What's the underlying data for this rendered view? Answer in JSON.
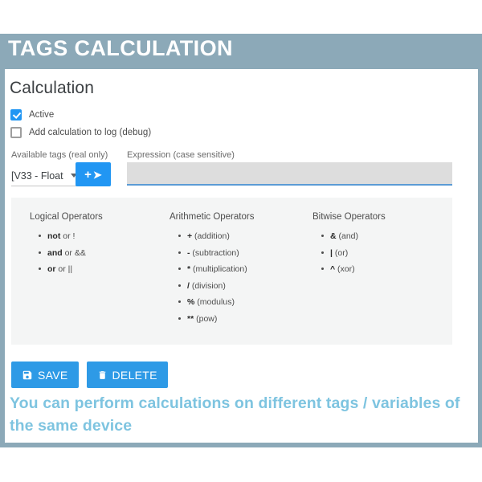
{
  "header": {
    "title": "TAGS CALCULATION",
    "bar_color": "#8ca9b8"
  },
  "card": {
    "title": "Calculation",
    "checkboxes": [
      {
        "label": "Active",
        "checked": true
      },
      {
        "label": "Add calculation to log (debug)",
        "checked": false
      }
    ],
    "tags_field": {
      "label": "Available tags (real only)",
      "selected_option": "[V33 - Float",
      "add_button": {
        "plus_icon": "+",
        "arrow_icon": "➤"
      }
    },
    "expression_field": {
      "label": "Expression (case sensitive)",
      "value": "",
      "placeholder": ""
    }
  },
  "help": {
    "columns": [
      {
        "heading": "Logical Operators",
        "items": [
          {
            "symbol": "not",
            "rest": " or !"
          },
          {
            "symbol": "and",
            "rest": " or &&"
          },
          {
            "symbol": "or",
            "rest": " or ||"
          }
        ]
      },
      {
        "heading": "Arithmetic Operators",
        "items": [
          {
            "symbol": "+",
            "rest": " (addition)"
          },
          {
            "symbol": "-",
            "rest": " (subtraction)"
          },
          {
            "symbol": "*",
            "rest": " (multiplication)"
          },
          {
            "symbol": "/",
            "rest": " (division)"
          },
          {
            "symbol": "%",
            "rest": " (modulus)"
          },
          {
            "symbol": "**",
            "rest": " (pow)"
          }
        ]
      },
      {
        "heading": "Bitwise Operators",
        "items": [
          {
            "symbol": "&",
            "rest": " (and)"
          },
          {
            "symbol": "|",
            "rest": " (or)"
          },
          {
            "symbol": "^",
            "rest": " (xor)"
          }
        ]
      }
    ]
  },
  "actions": {
    "save_label": "SAVE",
    "delete_label": "DELETE",
    "button_color": "#2e9ae6"
  },
  "caption": {
    "text": "You can perform calculations on different tags / variables of the same device",
    "color": "#7ec4e0"
  }
}
